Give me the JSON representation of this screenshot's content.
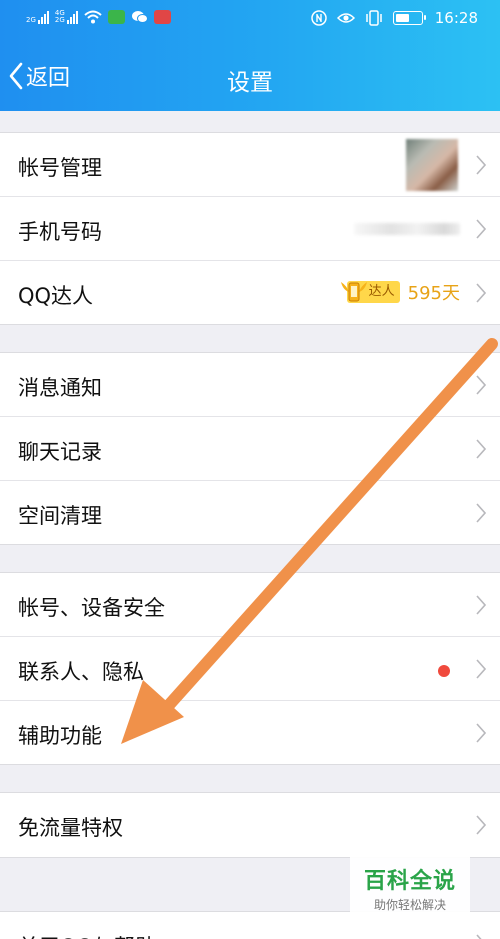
{
  "status_bar": {
    "sim1_label_top": "2G",
    "sim1_label_bottom": "",
    "sim2_label_top": "4G",
    "sim2_label_bottom": "2G",
    "time": "16:28",
    "battery_level": 0.55
  },
  "nav": {
    "back_label": "返回",
    "title": "设置"
  },
  "groups": [
    {
      "items": [
        {
          "label": "帐号管理"
        },
        {
          "label": "手机号码"
        },
        {
          "label": "QQ达人",
          "badge_label": "达人",
          "days": "595天"
        }
      ]
    },
    {
      "items": [
        {
          "label": "消息通知"
        },
        {
          "label": "聊天记录"
        },
        {
          "label": "空间清理"
        }
      ]
    },
    {
      "items": [
        {
          "label": "帐号、设备安全"
        },
        {
          "label": "联系人、隐私"
        },
        {
          "label": "辅助功能"
        }
      ]
    },
    {
      "items": [
        {
          "label": "免流量特权"
        }
      ]
    },
    {
      "items": [
        {
          "label": "关于QQ与帮助"
        }
      ]
    }
  ],
  "watermark": {
    "title": "百科全说",
    "subtitle": "助你轻松解决"
  },
  "colors": {
    "header_gradient_start": "#1f8ff0",
    "header_gradient_end": "#2cc1f3",
    "arrow": "#f0914a",
    "daren_text": "#e8a317",
    "red_dot": "#f04a3d",
    "watermark_green": "#2aa449"
  },
  "icons": [
    "back-chevron-icon",
    "wifi-icon",
    "chat-icon",
    "eye-icon",
    "vibrate-icon",
    "battery-icon",
    "chevron-right-icon",
    "daren-wing-icon"
  ]
}
